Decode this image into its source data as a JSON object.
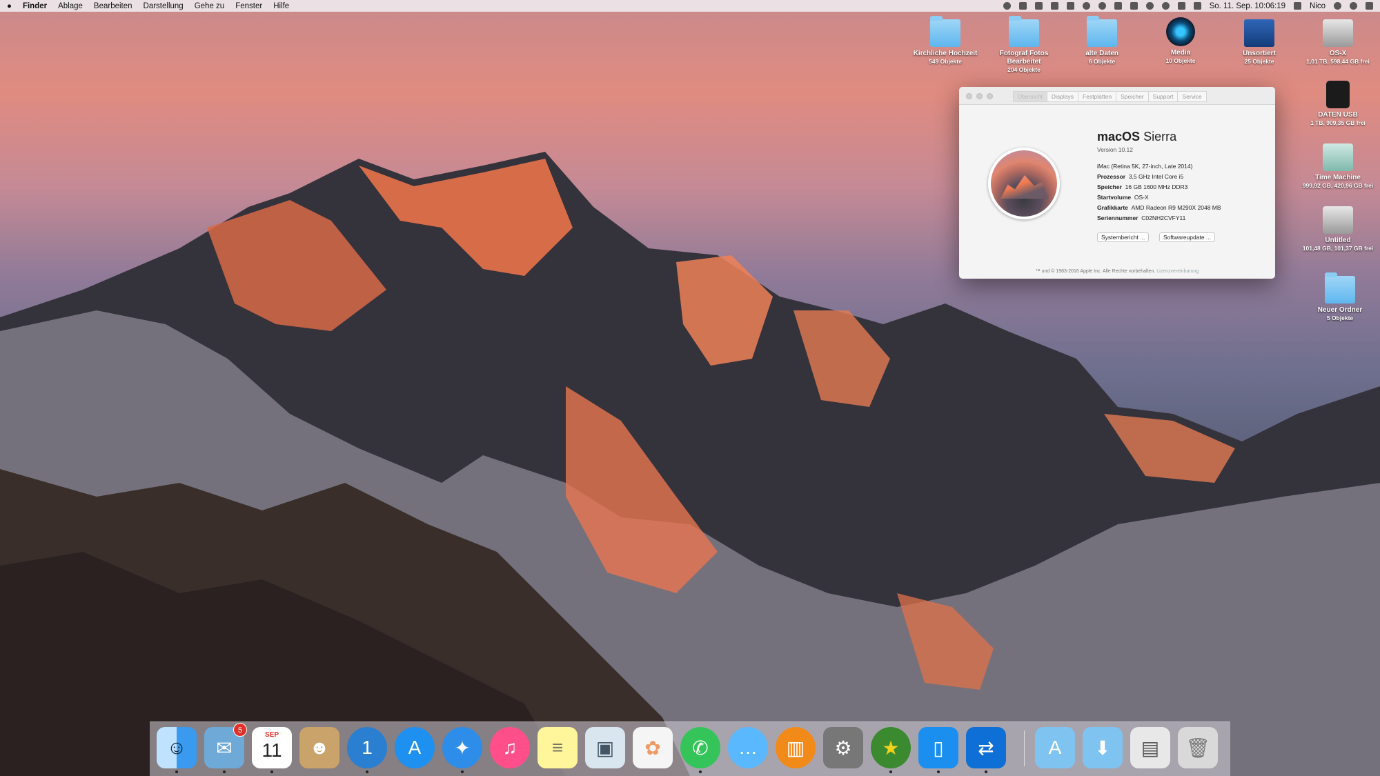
{
  "menubar": {
    "apple": "",
    "app": "Finder",
    "menus": [
      "Ablage",
      "Bearbeiten",
      "Darstellung",
      "Gehe zu",
      "Fenster",
      "Hilfe"
    ],
    "clock": "So. 11. Sep.  10:06:19",
    "user": "Nico"
  },
  "desktop_icons": [
    {
      "name": "Kirchliche Hochzeit",
      "sub": "549 Objekte",
      "kind": "folder"
    },
    {
      "name": "Fotograf Fotos Bearbeitet",
      "sub": "204 Objekte",
      "kind": "folder"
    },
    {
      "name": "alte Daten",
      "sub": "6 Objekte",
      "kind": "folder"
    },
    {
      "name": "Media",
      "sub": "10 Objekte",
      "kind": "media"
    },
    {
      "name": "Unsortiert",
      "sub": "25 Objekte",
      "kind": "unsort"
    },
    {
      "name": "OS-X",
      "sub": "1,01 TB, 598,44 GB frei",
      "kind": "drive"
    },
    {
      "name": "DATEN USB",
      "sub": "1 TB, 909,35 GB frei",
      "kind": "usb"
    },
    {
      "name": "Time Machine",
      "sub": "999,92 GB, 420,96 GB frei",
      "kind": "tm"
    },
    {
      "name": "Untitled",
      "sub": "101,48 GB, 101,37 GB frei",
      "kind": "drive"
    },
    {
      "name": "Neuer Ordner",
      "sub": "5 Objekte",
      "kind": "folder"
    }
  ],
  "about": {
    "tabs": [
      "Übersicht",
      "Displays",
      "Festplatten",
      "Speicher",
      "Support",
      "Service"
    ],
    "os_name_bold": "macOS",
    "os_name_light": "Sierra",
    "version": "Version 10.12",
    "model": "iMac (Retina 5K, 27-inch, Late 2014)",
    "specs": [
      {
        "k": "Prozessor",
        "v": "3,5 GHz Intel Core i5"
      },
      {
        "k": "Speicher",
        "v": "16 GB 1600 MHz DDR3"
      },
      {
        "k": "Startvolume",
        "v": "OS-X"
      },
      {
        "k": "Grafikkarte",
        "v": "AMD Radeon R9 M290X 2048 MB"
      },
      {
        "k": "Seriennummer",
        "v": "C02NH2CVFY11"
      }
    ],
    "btn_report": "Systembericht ...",
    "btn_update": "Softwareupdate ...",
    "copyright": "™ und © 1983-2016 Apple Inc. Alle Rechte vorbehalten.",
    "license": "Lizenzvereinbarung"
  },
  "dock": {
    "items": [
      {
        "name": "Finder",
        "icon": "finder-icon",
        "color": "#3aa0f0"
      },
      {
        "name": "Mail",
        "icon": "mail-icon",
        "color": "#6ea9d8",
        "badge": "5"
      },
      {
        "name": "Kalender",
        "icon": "calendar-icon",
        "color": "#ffffff",
        "month": "SEP",
        "day": "11"
      },
      {
        "name": "Kontakte",
        "icon": "contacts-icon",
        "color": "#c9a36a"
      },
      {
        "name": "1Password",
        "icon": "1password-icon",
        "color": "#2a7fd0"
      },
      {
        "name": "App Store",
        "icon": "appstore-icon",
        "color": "#1e90f0"
      },
      {
        "name": "Safari",
        "icon": "safari-icon",
        "color": "#2e8de8"
      },
      {
        "name": "iTunes",
        "icon": "itunes-icon",
        "color": "#ff4f8a"
      },
      {
        "name": "Notizen",
        "icon": "notes-icon",
        "color": "#fff59a"
      },
      {
        "name": "Vorschau",
        "icon": "preview-icon",
        "color": "#d9e6ef"
      },
      {
        "name": "Fotos",
        "icon": "photos-icon",
        "color": "#f5f5f5"
      },
      {
        "name": "WhatsApp",
        "icon": "whatsapp-icon",
        "color": "#35c45a"
      },
      {
        "name": "Nachrichten",
        "icon": "messages-icon",
        "color": "#5ab8ff"
      },
      {
        "name": "iBooks",
        "icon": "ibooks-icon",
        "color": "#f28a1a"
      },
      {
        "name": "Systemeinstellungen",
        "icon": "settings-icon",
        "color": "#777777"
      },
      {
        "name": "Jdownloader",
        "icon": "jdownloader-icon",
        "color": "#3b8a2f"
      },
      {
        "name": "1Blocker",
        "icon": "blocker-icon",
        "color": "#1a8ff0"
      },
      {
        "name": "TeamViewer",
        "icon": "teamviewer-icon",
        "color": "#0e6fd6"
      },
      {
        "name": "Programme",
        "icon": "applications-folder-icon",
        "color": "#7fc3f0"
      },
      {
        "name": "Downloads",
        "icon": "downloads-folder-icon",
        "color": "#7fc3f0"
      },
      {
        "name": "Bildschirmfotos",
        "icon": "screenshots-icon",
        "color": "#e8e8e8"
      },
      {
        "name": "Papierkorb",
        "icon": "trash-icon",
        "color": "#d9d9d9"
      }
    ]
  }
}
